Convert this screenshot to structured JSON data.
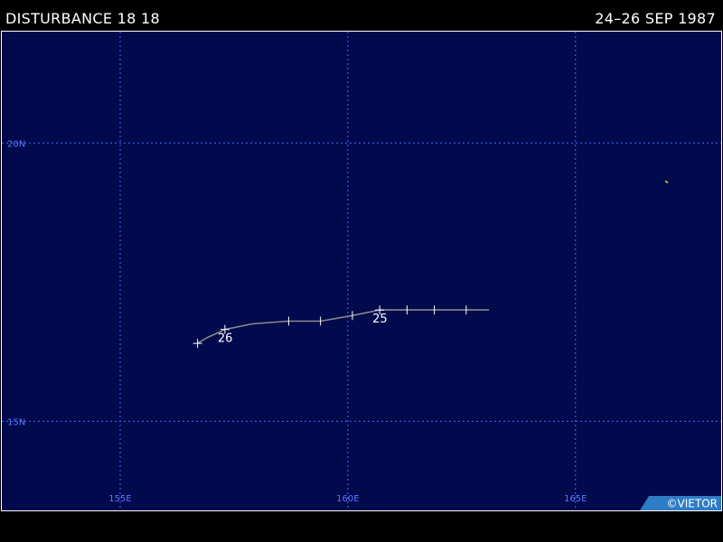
{
  "header": {
    "storm_name": "DISTURBANCE 18 18",
    "date_range": "24–26 SEP 1987"
  },
  "map": {
    "background_color": "#000a4c",
    "grid_color": "#4b68ff",
    "label_color": "#5c76ff",
    "track_color": "#8a8a8a",
    "marker_color": "#ffffff",
    "stray_mark_color": "#ffd200",
    "lon_range": [
      152.4,
      168.2
    ],
    "lat_range": [
      13.4,
      22.0
    ],
    "latitude_lines": [
      {
        "value": 20,
        "label": "20N"
      },
      {
        "value": 15,
        "label": "15N"
      }
    ],
    "longitude_lines": [
      {
        "value": 155,
        "label": "155E"
      },
      {
        "value": 160,
        "label": "160E"
      },
      {
        "value": 165,
        "label": "165E"
      }
    ],
    "track": [
      {
        "lon": 163.1,
        "lat": 17.0
      },
      {
        "lon": 162.6,
        "lat": 17.0,
        "tick": true
      },
      {
        "lon": 161.9,
        "lat": 17.0,
        "tick": true
      },
      {
        "lon": 161.3,
        "lat": 17.0,
        "tick": true
      },
      {
        "lon": 160.7,
        "lat": 17.0,
        "tick": true,
        "day_label": "25"
      },
      {
        "lon": 160.1,
        "lat": 16.9,
        "tick": true
      },
      {
        "lon": 159.4,
        "lat": 16.8,
        "tick": true
      },
      {
        "lon": 158.7,
        "lat": 16.8,
        "tick": true
      },
      {
        "lon": 157.9,
        "lat": 16.75
      },
      {
        "lon": 157.3,
        "lat": 16.65,
        "tick": true,
        "day_label": "26"
      },
      {
        "lon": 156.9,
        "lat": 16.5
      },
      {
        "lon": 156.7,
        "lat": 16.4,
        "tick": true
      }
    ],
    "stray_mark": {
      "lon": 167.0,
      "lat": 19.3
    }
  },
  "credit": {
    "text": "©VIETOR",
    "background_color": "#2e7cc6"
  }
}
